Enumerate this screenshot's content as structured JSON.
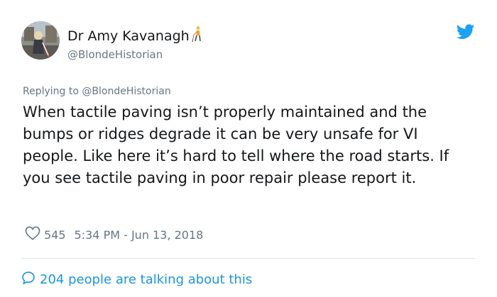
{
  "author": {
    "display_name": "Dr Amy Kavanagh",
    "handle": "@BlondeHistorian",
    "avatar_icon": "profile-photo",
    "name_emoji_icon": "person-with-white-cane-icon"
  },
  "reply": {
    "prefix": "Replying to",
    "handle": "@BlondeHistorian"
  },
  "tweet": {
    "text": "When tactile paving isn’t properly maintained and the bumps or ridges degrade it can be very unsafe for VI people. Like here it’s hard to tell where the road starts. If you see tactile paving in poor repair please report it."
  },
  "meta": {
    "likes": "545",
    "time": "5:34 PM - Jun 13, 2018"
  },
  "conversation": {
    "label": "204 people are talking about this"
  },
  "colors": {
    "brand_blue": "#1da1f2",
    "link_blue": "#1b95e0",
    "secondary_text": "#657786",
    "primary_text": "#14171a",
    "divider": "#e1e8ed"
  }
}
